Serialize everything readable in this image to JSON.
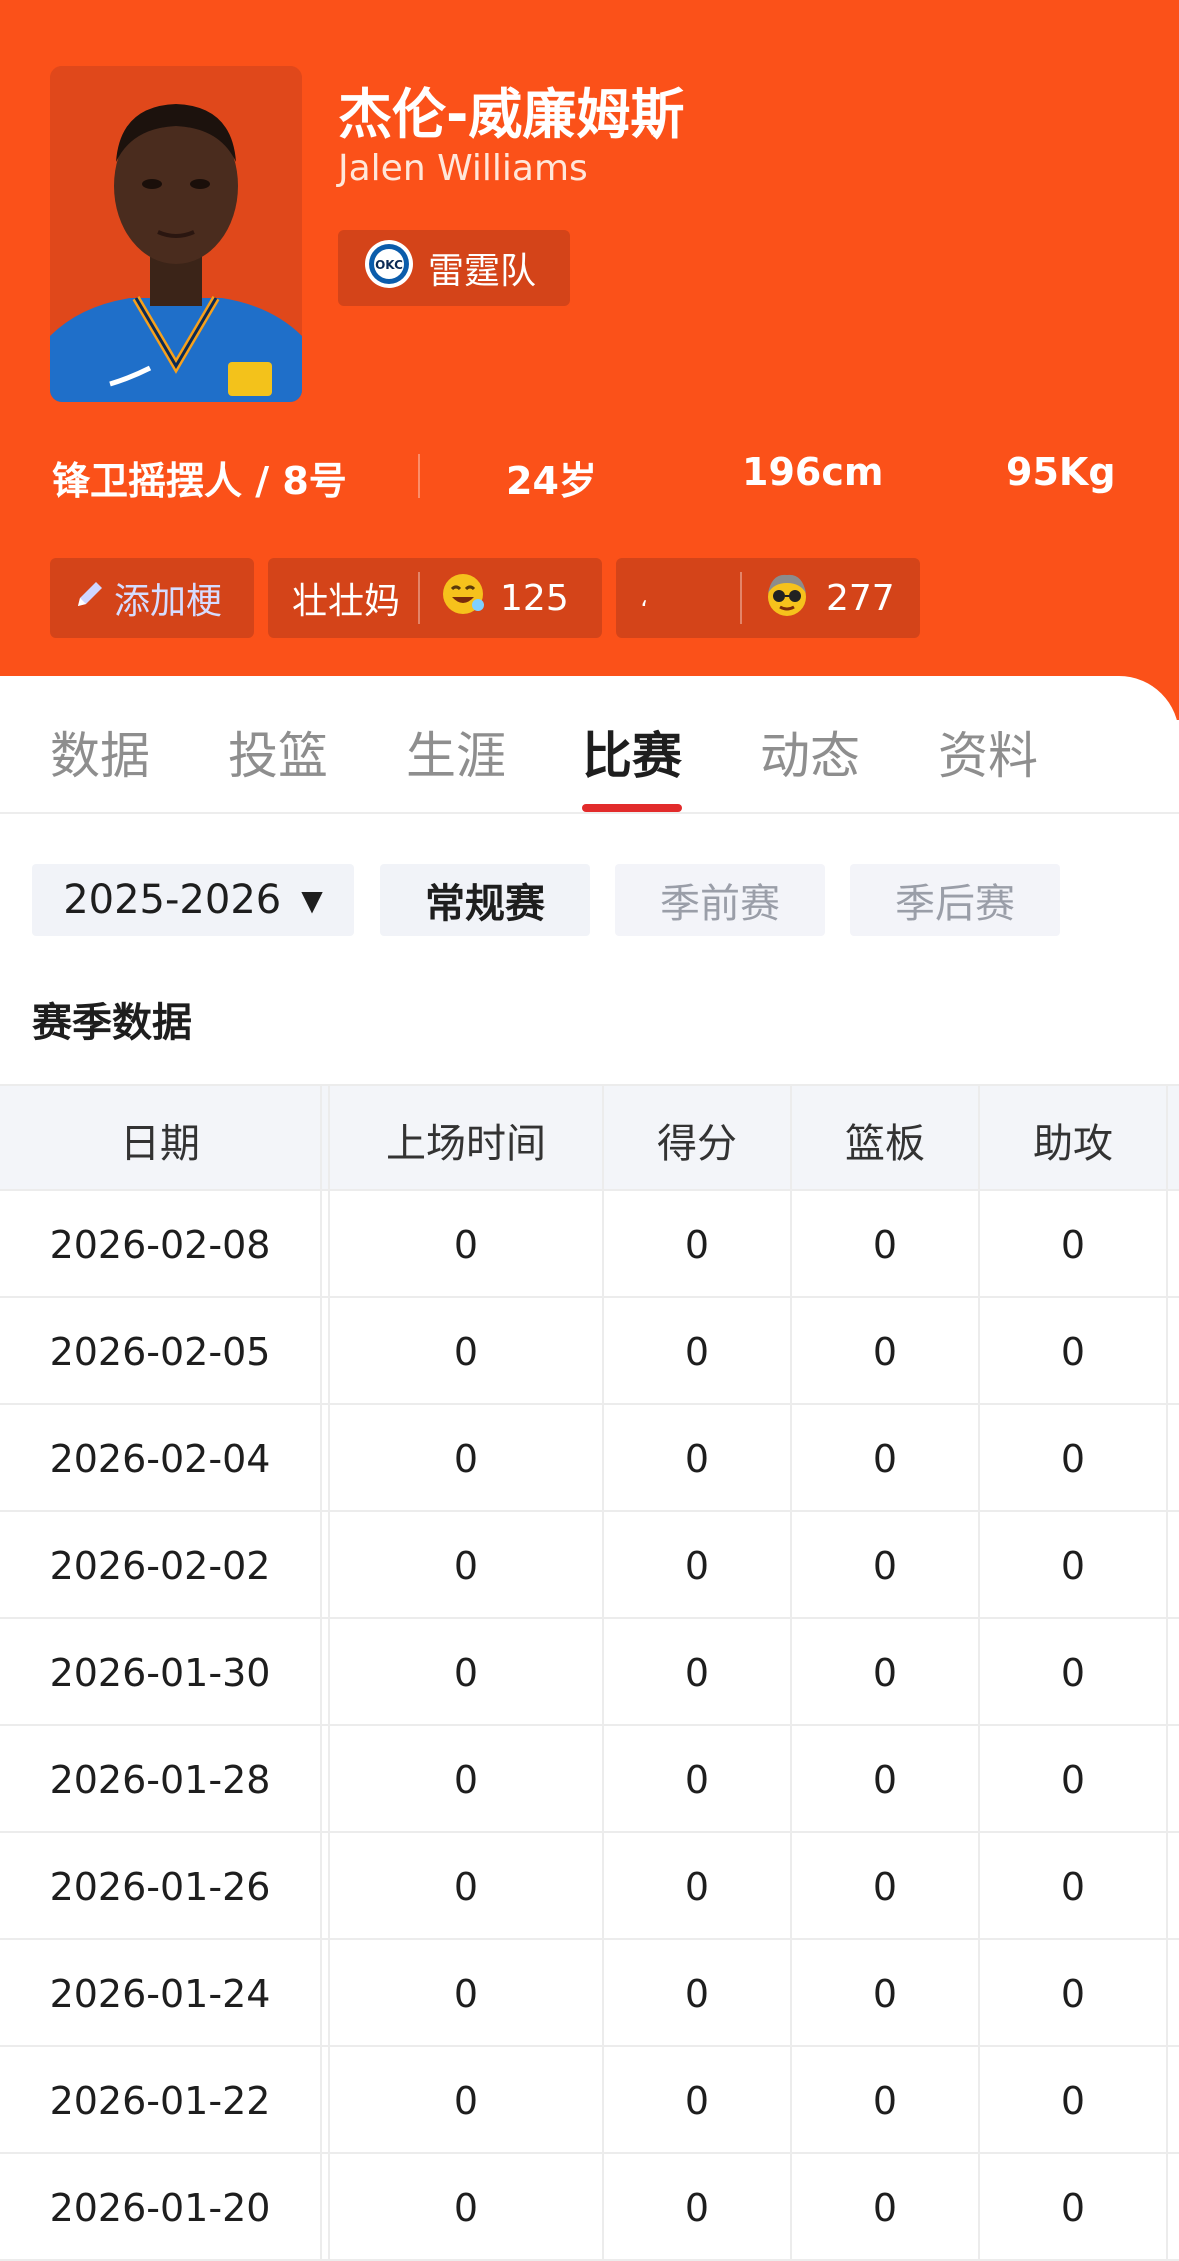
{
  "player": {
    "name_cn": "杰伦-威廉姆斯",
    "name_en": "Jalen Williams",
    "team": "雷霆队",
    "team_logo_text": "OKC",
    "position_number": "锋卫摇摆人 / 8号",
    "age": "24岁",
    "height": "196cm",
    "weight": "95Kg"
  },
  "chips": {
    "add_label": "添加梗",
    "nickname": "壮壮妈",
    "nickname_count": "125",
    "hidden_text": "،",
    "second_count": "277"
  },
  "tabs": [
    {
      "label": "数据",
      "active": false
    },
    {
      "label": "投篮",
      "active": false
    },
    {
      "label": "生涯",
      "active": false
    },
    {
      "label": "比赛",
      "active": true
    },
    {
      "label": "动态",
      "active": false
    },
    {
      "label": "资料",
      "active": false
    }
  ],
  "filters": {
    "season": "2025-2026",
    "regular": "常规赛",
    "preseason": "季前赛",
    "playoffs": "季后赛"
  },
  "section_title": "赛季数据",
  "table": {
    "headers": [
      "日期",
      "上场时间",
      "得分",
      "篮板",
      "助攻"
    ],
    "rows": [
      [
        "2026-02-08",
        "0",
        "0",
        "0",
        "0"
      ],
      [
        "2026-02-05",
        "0",
        "0",
        "0",
        "0"
      ],
      [
        "2026-02-04",
        "0",
        "0",
        "0",
        "0"
      ],
      [
        "2026-02-02",
        "0",
        "0",
        "0",
        "0"
      ],
      [
        "2026-01-30",
        "0",
        "0",
        "0",
        "0"
      ],
      [
        "2026-01-28",
        "0",
        "0",
        "0",
        "0"
      ],
      [
        "2026-01-26",
        "0",
        "0",
        "0",
        "0"
      ],
      [
        "2026-01-24",
        "0",
        "0",
        "0",
        "0"
      ],
      [
        "2026-01-22",
        "0",
        "0",
        "0",
        "0"
      ],
      [
        "2026-01-20",
        "0",
        "0",
        "0",
        "0"
      ]
    ]
  },
  "colors": {
    "header_bg": "#fb5119",
    "chip_bg": "#d44419",
    "tab_underline": "#e22b2b"
  }
}
